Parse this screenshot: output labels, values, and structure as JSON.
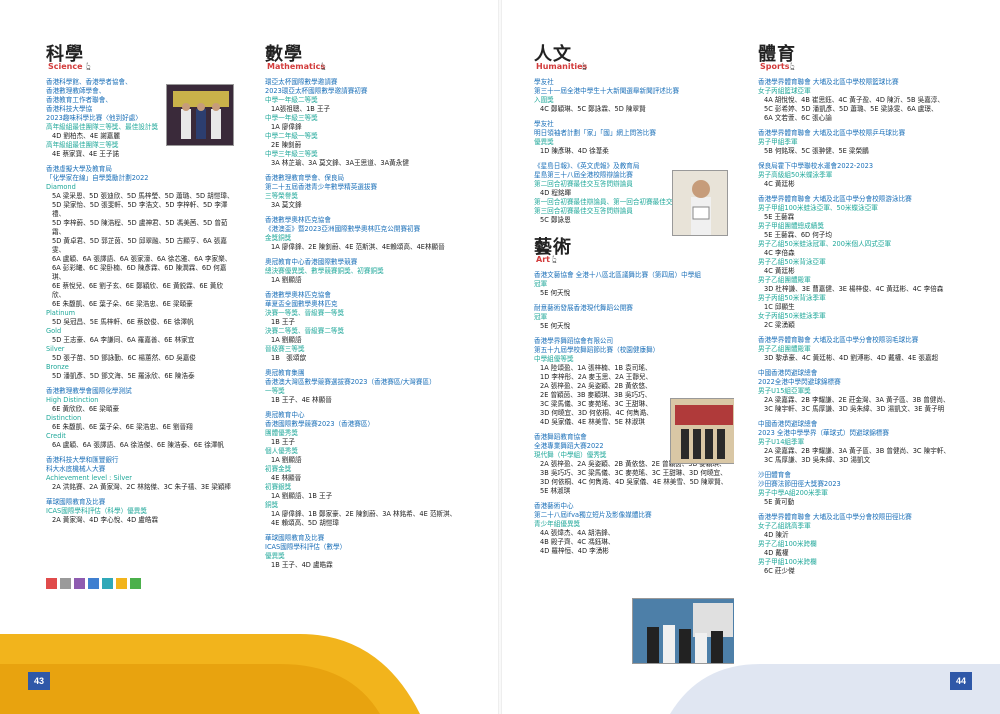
{
  "page_numbers": {
    "left": "43",
    "right": "44"
  },
  "colors": {
    "org_blue": "#1a6fb8",
    "award_teal": "#20a89a",
    "heading_accent": "#d23b3b",
    "footer_gold": "#f2b41c",
    "footer_navy": "#2f58a8",
    "swatches": [
      "#e04b4b",
      "#9a9a9a",
      "#8e5bb0",
      "#3f7fd0",
      "#2fa8b8",
      "#f2b41c",
      "#4bb04b"
    ]
  },
  "sections": {
    "science": {
      "zh": "科學",
      "en": "Science",
      "lines": [
        {
          "t": "org",
          "v": "香港科學館、香港學者協會、"
        },
        {
          "t": "org",
          "v": "香港數理教師學會、"
        },
        {
          "t": "org",
          "v": "香港教育工作者聯會、"
        },
        {
          "t": "org",
          "v": "香港科技大學協"
        },
        {
          "t": "org",
          "v": "2023趣味科學比賽〈他到好處〉"
        },
        {
          "t": "award",
          "v": "高年級組最佳團隊三等獎、最佳設計獎"
        },
        {
          "t": "item",
          "v": "4D 劉柏杰、4E 謝嘉麗"
        },
        {
          "t": "award",
          "v": "高年級組最佳團隊三等獎"
        },
        {
          "t": "item",
          "v": "4E 蔡家寶、4E 王子諾"
        },
        {
          "t": "gap"
        },
        {
          "t": "org",
          "v": "香港虛擬大學及教育局"
        },
        {
          "t": "org",
          "v": "「化學家在線」自學獎勵計劃2022"
        },
        {
          "t": "award",
          "v": "Diamond"
        },
        {
          "t": "item",
          "v": "5A 梁采恩、5D 張迪欣、5D 馬梓瑩、5D 蕭璐、5D 胡愷瑋、"
        },
        {
          "t": "item",
          "v": "5D 梁家怡、5D 張斐軒、5D 李浩文、5D 李梓軒、5D 李澤禮、"
        },
        {
          "t": "item",
          "v": "5D 李梓蔚、5D 陳浩程、5D 盧神君、5D 馮美茜、5D 曾茹霜、"
        },
        {
          "t": "item",
          "v": "5D 黃卓君、5D 郭芷茵、5D 邱翠融、5D 古顯亨、6A 張嘉雯、"
        },
        {
          "t": "item",
          "v": "6A 盧穎、6A 張譯語、6A 張家濠、6A 徐芯雅、6A 李家樂、"
        },
        {
          "t": "item",
          "v": "6A 彭彩曦、6C 梁卧楠、6D 陳彥霖、6D 陳潤霖、6D 何嘉琪、"
        },
        {
          "t": "item",
          "v": "6E 蔡悅兒、6E 劉子玄、6E 鄭穎欣、6E 黃鋭霖、6E 黃欣欣、"
        },
        {
          "t": "item",
          "v": "6E 朱馥凱、6E 葉子朵、6E 梁浩忠、6E 梁頤豪"
        },
        {
          "t": "award",
          "v": "Platinum"
        },
        {
          "t": "item",
          "v": "5D 吳冠昌、5E 馬梓軒、6E 蔡啟俊、6E 徐澤帆"
        },
        {
          "t": "award",
          "v": "Gold"
        },
        {
          "t": "item",
          "v": "5D 王志豪、6A 李謙同、6A 羅嘉善、6E 林家宜"
        },
        {
          "t": "award",
          "v": "Silver"
        },
        {
          "t": "item",
          "v": "5D 張子苗、5D 鄧詠勤、6C 楊蕙然、6D 吳嘉俊"
        },
        {
          "t": "award",
          "v": "Bronze"
        },
        {
          "t": "item",
          "v": "5D 潘凱彥、5D 鄧文海、5E 羅泳欣、6E 陳浩泰"
        },
        {
          "t": "gap"
        },
        {
          "t": "org",
          "v": "香港數理教學會國際化學測試"
        },
        {
          "t": "award",
          "v": "High Distinction"
        },
        {
          "t": "item",
          "v": "6E 黃欣欣、6E 梁頤豪"
        },
        {
          "t": "award",
          "v": "Distinction"
        },
        {
          "t": "item",
          "v": "6E 朱馥凱、6E 葉子朵、6E 梁浩忠、6E 劉晉翔"
        },
        {
          "t": "award",
          "v": "Credit"
        },
        {
          "t": "item",
          "v": "6A 盧穎、6A 張譯語、6A 徐浩傑、6E 陳浩泰、6E 徐澤帆"
        },
        {
          "t": "gap"
        },
        {
          "t": "org",
          "v": "香港科技大學和匯豐銀行"
        },
        {
          "t": "org",
          "v": "科大水底機械人大賽"
        },
        {
          "t": "award",
          "v": "Achievement level : Silver"
        },
        {
          "t": "item",
          "v": "2A 洪銘賽、2A 黃家灣、2C 林銘傑、3C 朱子禧、3E 梁穎棒"
        },
        {
          "t": "gap"
        },
        {
          "t": "org",
          "v": "華球國際教育及比賽"
        },
        {
          "t": "award",
          "v": "ICAS國際學科評估（科學）優異獎"
        },
        {
          "t": "item",
          "v": "2A 黃家灣、4D 李心悅、4D 盧皓霖"
        }
      ]
    },
    "math": {
      "zh": "數學",
      "en": "Mathematics",
      "lines": [
        {
          "t": "org",
          "v": "環亞太杯國際數學邀請賽"
        },
        {
          "t": "org",
          "v": "2023環亞太杯國際數學邀請賽初賽"
        },
        {
          "t": "award",
          "v": "中學一年級二等獎"
        },
        {
          "t": "item",
          "v": "1A張祖聰、1B 王子"
        },
        {
          "t": "award",
          "v": "中學一年級三等獎"
        },
        {
          "t": "item",
          "v": "1A 廖偉鋒"
        },
        {
          "t": "award",
          "v": "中學二年級一等獎"
        },
        {
          "t": "item",
          "v": "2E 陳釗蔚"
        },
        {
          "t": "award",
          "v": "中學三年級三等獎"
        },
        {
          "t": "item",
          "v": "3A 林芷瑜、3A 莫文鋒、3A王思道、3A黃永健"
        },
        {
          "t": "gap"
        },
        {
          "t": "org",
          "v": "香港數理教育學會、保良局"
        },
        {
          "t": "org",
          "v": "第二十五屆香港青少年數學精英選拔賽"
        },
        {
          "t": "award",
          "v": "三等榮譽獎"
        },
        {
          "t": "item",
          "v": "3A 莫文鋒"
        },
        {
          "t": "gap"
        },
        {
          "t": "org",
          "v": "香港數學奧林匹克協會"
        },
        {
          "t": "org",
          "v": "《港澳盃》暨2023亞洲國際數學奧林匹克公開賽初賽"
        },
        {
          "t": "award",
          "v": "金獎銅獎"
        },
        {
          "t": "item",
          "v": "1A 廖偉鋒、2E 陳釗蔚、4E 范斯淇、4E賴頌高、4E林顯晉"
        },
        {
          "t": "gap"
        },
        {
          "t": "org",
          "v": "奧冠教育中心香港國際數學競賽"
        },
        {
          "t": "award",
          "v": "總決賽優異獎、數學競賽銅獎、初賽銅獎"
        },
        {
          "t": "item",
          "v": "1A 劉顯語"
        },
        {
          "t": "gap"
        },
        {
          "t": "org",
          "v": "香港數學奧林匹克協會"
        },
        {
          "t": "org",
          "v": "華夏盃全國數學奧林匹克"
        },
        {
          "t": "award",
          "v": "決賽一等獎、晉級賽一等獎"
        },
        {
          "t": "item",
          "v": "1B 王子"
        },
        {
          "t": "award",
          "v": "決賽二等獎、晉級賽二等獎"
        },
        {
          "t": "item",
          "v": "1A 劉顯語"
        },
        {
          "t": "award",
          "v": "晉級賽三等獎"
        },
        {
          "t": "item",
          "v": "1B　張頌歆"
        },
        {
          "t": "gap"
        },
        {
          "t": "org",
          "v": "奧冠教育集團"
        },
        {
          "t": "org",
          "v": "香港澳大灣區數學競賽選拔賽2023（香港賽區/大灣賽區）"
        },
        {
          "t": "award",
          "v": "一等獎"
        },
        {
          "t": "item",
          "v": "1B 王子、4E 林顯晉"
        },
        {
          "t": "gap"
        },
        {
          "t": "org",
          "v": "奧冠教育中心"
        },
        {
          "t": "org",
          "v": "香港國際數學競賽2023（香港賽區）"
        },
        {
          "t": "award",
          "v": "團體優秀獎"
        },
        {
          "t": "item",
          "v": "1B 王子"
        },
        {
          "t": "award",
          "v": "個人優秀獎"
        },
        {
          "t": "item",
          "v": "1A 劉顯語"
        },
        {
          "t": "award",
          "v": "初賽金獎"
        },
        {
          "t": "item",
          "v": "4E 林顯晉"
        },
        {
          "t": "award",
          "v": "初賽銀獎"
        },
        {
          "t": "item",
          "v": "1A 劉顯語、1B 王子"
        },
        {
          "t": "award",
          "v": "銅獎"
        },
        {
          "t": "item",
          "v": "1A 廖偉鋒、1B 鄭家豪、2E 陳釗蔚、3A 林銘希、4E 范斯淇、"
        },
        {
          "t": "item",
          "v": "4E 賴頌高、5D 胡愷瑋"
        },
        {
          "t": "gap"
        },
        {
          "t": "org",
          "v": "華球國際教育及比賽"
        },
        {
          "t": "org",
          "v": "ICAS國際學科評估（數學）"
        },
        {
          "t": "award",
          "v": "優異獎"
        },
        {
          "t": "item",
          "v": "1B 王子、4D 盧皓霖"
        }
      ]
    },
    "humanities": {
      "zh": "人文",
      "en": "Humanities",
      "lines": [
        {
          "t": "org",
          "v": "學友社"
        },
        {
          "t": "org",
          "v": "第三十一屆全港中學生十大新聞選舉新聞評述比賽"
        },
        {
          "t": "award",
          "v": "入圍獎"
        },
        {
          "t": "item",
          "v": "4C 鄭穎琳、5C 鄭詠霖、5D 陳翠賢"
        },
        {
          "t": "gap"
        },
        {
          "t": "org",
          "v": "學友社"
        },
        {
          "t": "org",
          "v": "明日領袖者計劃「家」「國」網上問答比賽"
        },
        {
          "t": "award",
          "v": "優異獎"
        },
        {
          "t": "item",
          "v": "1D 陳彥琳、4D 徐葦柔"
        },
        {
          "t": "gap"
        },
        {
          "t": "org",
          "v": "《星島日報》、《英文虎報》及教育局"
        },
        {
          "t": "org",
          "v": "星島第三十八屆全港校際辯論比賽"
        },
        {
          "t": "award",
          "v": "第二回合初賽最佳交互答問辯論員"
        },
        {
          "t": "item",
          "v": "4D 程銘暉"
        },
        {
          "t": "award",
          "v": "第一回合初賽最佳辯論員、第一回合初賽最佳交互答問辯論員、"
        },
        {
          "t": "award",
          "v": "第三回合初賽最佳交互答問辯論員"
        },
        {
          "t": "item",
          "v": "5C 鄭詠恩"
        }
      ]
    },
    "art": {
      "zh": "藝術",
      "en": "Art",
      "lines": [
        {
          "t": "org",
          "v": "香港文藝協會 全港十八區北區議舞比賽（第四屆）中學組"
        },
        {
          "t": "award",
          "v": "冠軍"
        },
        {
          "t": "item",
          "v": "5E 何天悅"
        },
        {
          "t": "gap"
        },
        {
          "t": "org",
          "v": "耐意藝術發展香港現代舞蹈公開賽"
        },
        {
          "t": "award",
          "v": "冠軍"
        },
        {
          "t": "item",
          "v": "5E 何天悅"
        },
        {
          "t": "gap"
        },
        {
          "t": "org",
          "v": "香港學界舞蹈協會有限公司"
        },
        {
          "t": "org",
          "v": "第五十九屆學校舞蹈節比賽（校園健康舞）"
        },
        {
          "t": "award",
          "v": "中學組優等獎"
        },
        {
          "t": "item",
          "v": "1A 陸頌盈、1A 張梓楠、1B 袁司瑤、"
        },
        {
          "t": "item",
          "v": "1D 李梓彤、2A 麥玉思、2A 王靜兒、"
        },
        {
          "t": "item",
          "v": "2A 張梓盈、2A 吳姿穎、2B 黃依悠、"
        },
        {
          "t": "item",
          "v": "2E 曾穎茵、3B 麥穎琪、3B 吳巧巧、"
        },
        {
          "t": "item",
          "v": "3C 梁馬儀、3C 麥苑瑤、3C 王甜琳、"
        },
        {
          "t": "item",
          "v": "3D 何曉宜、3D 何依桐、4C 何雋澔、"
        },
        {
          "t": "item",
          "v": "4D 吳家儀、4E 林美雪、5E 林淑琪"
        },
        {
          "t": "gap"
        },
        {
          "t": "org",
          "v": "香港舞蹈教育協會"
        },
        {
          "t": "org",
          "v": "全港專業舞蹈大賽2022"
        },
        {
          "t": "award",
          "v": "現代舞（中學組）優秀獎"
        },
        {
          "t": "item",
          "v": "2A 張梓盈、2A 吳姿穎、2B 黃依悠、2E 曾穎茵、3B 麥穎琪、"
        },
        {
          "t": "item",
          "v": "3B 吳巧巧、3C 梁馬儀、3C 麥苑瑤、3C 王甜琳、3D 何曉宜、"
        },
        {
          "t": "item",
          "v": "3D 何依桐、4C 何雋澔、4D 吳家儀、4E 林美雪、5D 陳翠賢、"
        },
        {
          "t": "item",
          "v": "5E 林淑琪"
        },
        {
          "t": "gap"
        },
        {
          "t": "org",
          "v": "香港藝術中心"
        },
        {
          "t": "org",
          "v": "第二十八屆ifva獨立短片及影像媒體比賽"
        },
        {
          "t": "award",
          "v": "青少年組優異獎"
        },
        {
          "t": "item",
          "v": "4A 張煒杰、4A 胡浩鋒、"
        },
        {
          "t": "item",
          "v": "4B 殿子齊、4C 馮鈺琳、"
        },
        {
          "t": "item",
          "v": "4D 羅梓恒、4D 李湧彬"
        }
      ]
    },
    "sports": {
      "zh": "體育",
      "en": "Sports",
      "lines": [
        {
          "t": "org",
          "v": "香港學界體育聯會 大埔及北區中學校際籃球比賽"
        },
        {
          "t": "award",
          "v": "女子丙組籃球亞軍"
        },
        {
          "t": "item",
          "v": "4A 胡悅悅、4B 崔思鈺、4C 黃子盈、4D 陳沂、5B 吳嘉淳、"
        },
        {
          "t": "item",
          "v": "5C 彭希婷、5D 潘凱彥、5D 蕭璐、5E 梁詠雯、6A 盧璟、"
        },
        {
          "t": "item",
          "v": "6A 文若萱、6C 張心諭"
        },
        {
          "t": "gap"
        },
        {
          "t": "org",
          "v": "香港學界體育聯會 大埔及北區中學校際乒乓球比賽"
        },
        {
          "t": "award",
          "v": "男子甲組季軍"
        },
        {
          "t": "item",
          "v": "5B 何銘琛、5C 張翀健、5E 梁榮鵬"
        },
        {
          "t": "gap"
        },
        {
          "t": "org",
          "v": "保良局霍下中學聯校水運會2022-2023"
        },
        {
          "t": "award",
          "v": "男子高級組50米蝶泳季軍"
        },
        {
          "t": "item",
          "v": "4C 黃廷彬"
        },
        {
          "t": "gap"
        },
        {
          "t": "org",
          "v": "香港學界體育聯會 大埔及北區中學分會校際游泳比賽"
        },
        {
          "t": "award",
          "v": "男子甲組100米蛙泳亞軍、50米蝶泳亞軍"
        },
        {
          "t": "item",
          "v": "5E 王藝霖"
        },
        {
          "t": "award",
          "v": "男子甲組團體總成績獎"
        },
        {
          "t": "item",
          "v": "5E 王藝霖、6D 何子均"
        },
        {
          "t": "award",
          "v": "男子乙組50米蛙泳冠軍、200米個人四式亞軍"
        },
        {
          "t": "item",
          "v": "4C 李倍森"
        },
        {
          "t": "award",
          "v": "男子乙組50米背泳亞軍"
        },
        {
          "t": "item",
          "v": "4C 黃廷彬"
        },
        {
          "t": "award",
          "v": "男子乙組團體殿軍"
        },
        {
          "t": "item",
          "v": "3D 杜梓謙、3E 曹嘉健、3E 楊梓俊、4C 黃廷彬、4C 李倍森"
        },
        {
          "t": "award",
          "v": "男子丙組50米背泳季軍"
        },
        {
          "t": "item",
          "v": "1C 邱顯生"
        },
        {
          "t": "award",
          "v": "女子丙組50米蛙泳季軍"
        },
        {
          "t": "item",
          "v": "2C 梁湧穎"
        },
        {
          "t": "gap"
        },
        {
          "t": "org",
          "v": "香港學界體育聯會 大埔及北區中學分會校際羽毛球比賽"
        },
        {
          "t": "award",
          "v": "男子乙組團體殿軍"
        },
        {
          "t": "item",
          "v": "3D 黎承豪、4C 黃廷彬、4D 劉溥彬、4D 戴權、4E 張嘉超"
        },
        {
          "t": "gap"
        },
        {
          "t": "org",
          "v": "中國香港閃避球總會"
        },
        {
          "t": "org",
          "v": "2022全港中學閃避球錦標賽"
        },
        {
          "t": "award",
          "v": "男子U15組亞軍獎"
        },
        {
          "t": "item",
          "v": "2A 梁嘉霖、2B 李耀謙、2E 莊金灣、3A 黃子區、3B 曾健尚、"
        },
        {
          "t": "item",
          "v": "3C 陳宇軒、3C 馬厚謙、3D 吳朱緯、3D 湯凱文、3E 黃子明"
        },
        {
          "t": "gap"
        },
        {
          "t": "org",
          "v": "中國香港閃避球總會"
        },
        {
          "t": "org",
          "v": "2023 全港中學學界（華球式）閃避球錦標賽"
        },
        {
          "t": "award",
          "v": "男子U14組季軍"
        },
        {
          "t": "item",
          "v": "2A 梁嘉霖、2B 李耀謙、3A 黃子區、3B 曾健尚、3C 陳宇軒、"
        },
        {
          "t": "item",
          "v": "3C 馬厚謙、3D 吳朱緯、3D 湯凱文"
        },
        {
          "t": "gap"
        },
        {
          "t": "org",
          "v": "沙田體育會"
        },
        {
          "t": "org",
          "v": "沙田賽法節田徑大獎賽2023"
        },
        {
          "t": "award",
          "v": "男子中學A組200米季軍"
        },
        {
          "t": "item",
          "v": "5E 黃可動"
        },
        {
          "t": "gap"
        },
        {
          "t": "org",
          "v": "香港學界體育聯會 大埔及北區中學分會校際田徑比賽"
        },
        {
          "t": "award",
          "v": "女子乙組跳高季軍"
        },
        {
          "t": "item",
          "v": "4D 陳沂"
        },
        {
          "t": "award",
          "v": "男子乙組100米跨欄"
        },
        {
          "t": "item",
          "v": "4D 戴權"
        },
        {
          "t": "award",
          "v": "男子甲組100米跨欄"
        },
        {
          "t": "item",
          "v": "6C 莊少傑"
        }
      ]
    }
  }
}
